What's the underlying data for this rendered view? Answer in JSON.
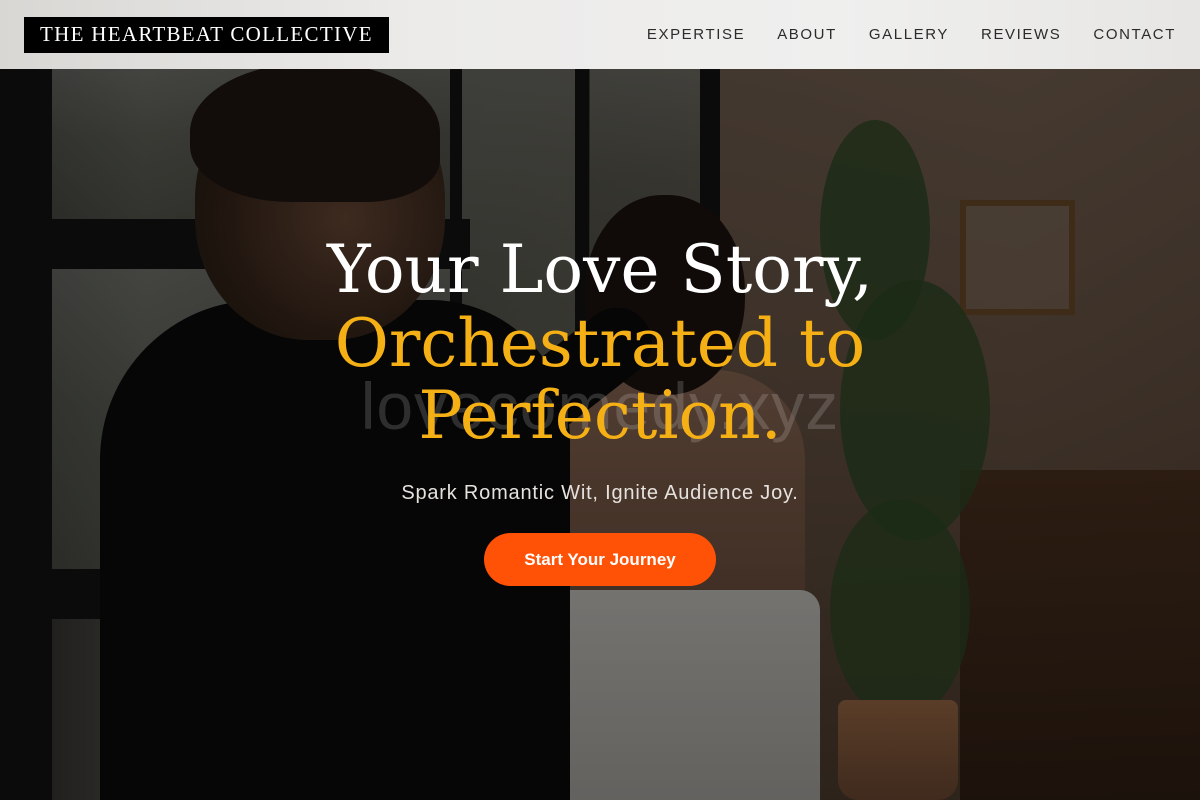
{
  "header": {
    "logo_text": "THE HEARTBEAT COLLECTIVE",
    "nav": [
      {
        "label": "EXPERTISE"
      },
      {
        "label": "ABOUT"
      },
      {
        "label": "GALLERY"
      },
      {
        "label": "REVIEWS"
      },
      {
        "label": "CONTACT"
      }
    ]
  },
  "hero": {
    "heading_line1": "Your Love Story,",
    "heading_line2": "Orchestrated to",
    "heading_line3": "Perfection.",
    "watermark": "lovecomedy.xyz",
    "tagline": "Spark Romantic Wit, Ignite Audience Joy.",
    "cta_label": "Start Your Journey"
  },
  "colors": {
    "accent_gold": "#f5b015",
    "cta_orange": "#ff5206",
    "logo_bg": "#000000"
  }
}
